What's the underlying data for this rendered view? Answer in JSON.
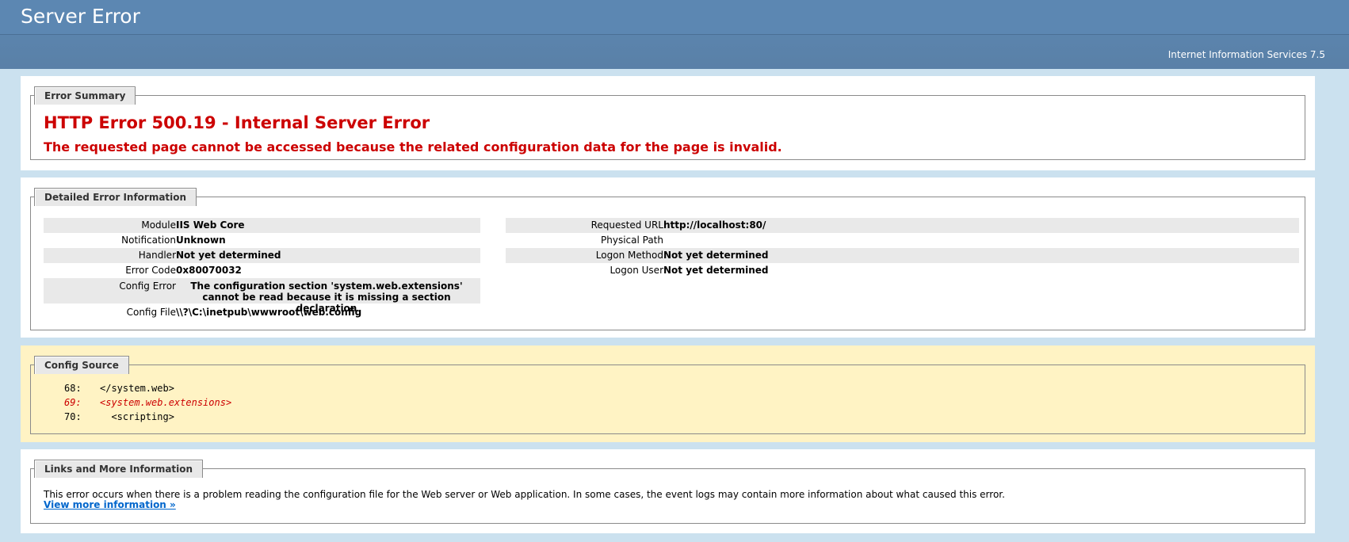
{
  "header": {
    "title": "Server Error"
  },
  "subheader": {
    "product": "Internet Information Services 7.5"
  },
  "summary": {
    "legend": "Error Summary",
    "title": "HTTP Error 500.19 - Internal Server Error",
    "subtitle": "The requested page cannot be accessed because the related configuration data for the page is invalid."
  },
  "details": {
    "legend": "Detailed Error Information",
    "left": [
      {
        "label": "Module",
        "value": "IIS Web Core"
      },
      {
        "label": "Notification",
        "value": "Unknown"
      },
      {
        "label": "Handler",
        "value": "Not yet determined"
      },
      {
        "label": "Error Code",
        "value": "0x80070032"
      },
      {
        "label": "Config Error",
        "value": "The configuration section 'system.web.extensions' cannot be read because it is missing a section declaration"
      },
      {
        "label": "Config File",
        "value": "\\\\?\\C:\\inetpub\\wwwroot\\web.config"
      }
    ],
    "right": [
      {
        "label": "Requested URL",
        "value": "http://localhost:80/"
      },
      {
        "label": "Physical Path",
        "value": ""
      },
      {
        "label": "Logon Method",
        "value": "Not yet determined"
      },
      {
        "label": "Logon User",
        "value": "Not yet determined"
      }
    ]
  },
  "config_source": {
    "legend": "Config Source",
    "lines": [
      {
        "num": "68:",
        "code": "</system.web>",
        "highlight": false
      },
      {
        "num": "69:",
        "code": "<system.web.extensions>",
        "highlight": true
      },
      {
        "num": "70:",
        "code": "  <scripting>",
        "highlight": false
      }
    ]
  },
  "links": {
    "legend": "Links and More Information",
    "text": "This error occurs when there is a problem reading the configuration file for the Web server or Web application. In some cases, the event logs may contain more information about what caused this error.",
    "link_label": "View more information »"
  },
  "colors": {
    "header_bg": "#5c87b2",
    "error_red": "#cc0000",
    "page_bg": "#cbe1ef",
    "source_bg": "#fff3c4",
    "link": "#0066cc"
  }
}
